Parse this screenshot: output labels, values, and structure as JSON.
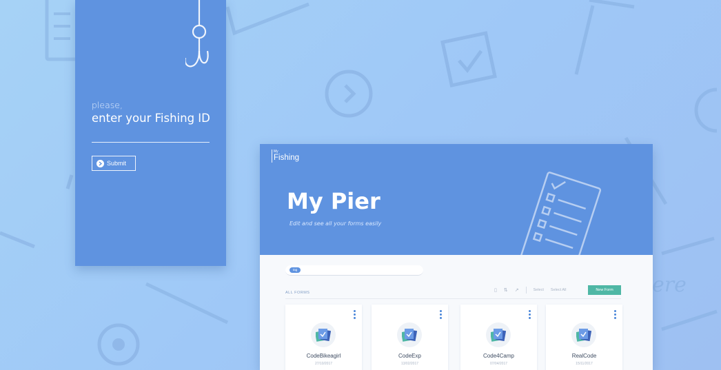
{
  "colors": {
    "background": "#a6d2f6",
    "panel_blue": "#5f93e0",
    "accent_green": "#4fb7a5",
    "card_icon_bg": "#eef2f7"
  },
  "login": {
    "icon": "fishing-hook-icon",
    "prompt_small": "please,",
    "prompt_title": "enter your Fishing ID",
    "submit_label": "Submit",
    "submit_icon": "arrow-right-circle-icon"
  },
  "app": {
    "logo_small": "My",
    "logo_big": "Fishing",
    "title": "My Pier",
    "subtitle": "Edit and see all your forms easily",
    "header_icon": "clipboard-checklist-icon",
    "search_tag": "tag",
    "section_label": "ALL FORMS",
    "toolbar": {
      "icons": [
        "trash-icon",
        "sort-icon",
        "share-icon"
      ],
      "select_label": "Select",
      "select_all_label": "Select All"
    },
    "new_form_label": "New Form",
    "forms": [
      {
        "name": "CodeBikeagirl",
        "date": "27/10/2017",
        "icon": "forms-stack-icon"
      },
      {
        "name": "CodeExp",
        "date": "13/02/2017",
        "icon": "forms-stack-icon"
      },
      {
        "name": "Code4Camp",
        "date": "07/04/2017",
        "icon": "forms-stack-icon"
      },
      {
        "name": "RealCode",
        "date": "15/11/2017",
        "icon": "forms-stack-icon"
      }
    ]
  }
}
